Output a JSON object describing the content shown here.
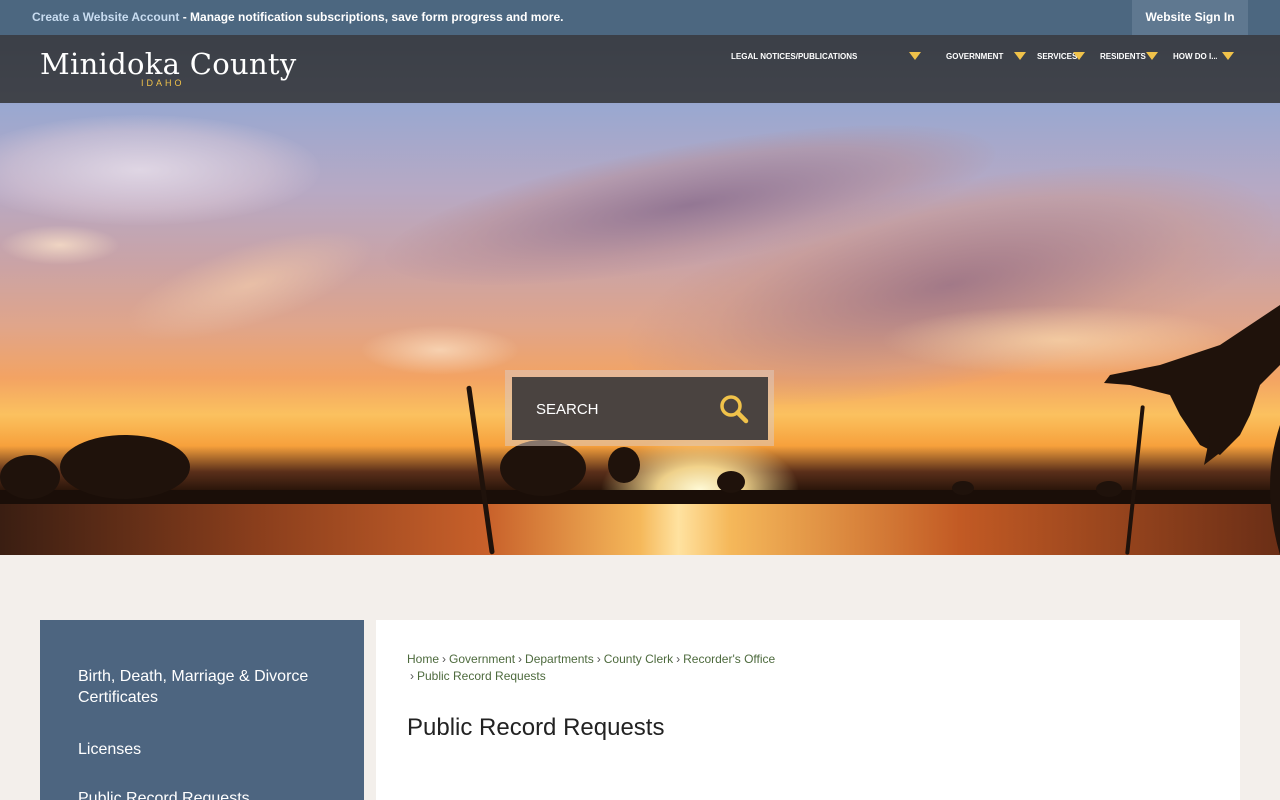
{
  "topbar": {
    "link_text": "Create a Website Account",
    "message": " - Manage notification subscriptions, save form progress and more.",
    "signin_label": "Website Sign In"
  },
  "header": {
    "logo_title": "Minidoka County",
    "logo_subtitle": "IDAHO",
    "nav": [
      {
        "label": "LEGAL NOTICES/PUBLICATIONS"
      },
      {
        "label": "GOVERNMENT"
      },
      {
        "label": "SERVICES"
      },
      {
        "label": "RESIDENTS"
      },
      {
        "label": "HOW DO I..."
      }
    ]
  },
  "search": {
    "placeholder": "SEARCH",
    "icon": "search-icon"
  },
  "sidebar": {
    "items": [
      {
        "label": "Birth, Death, Marriage & Divorce Certificates"
      },
      {
        "label": "Licenses"
      },
      {
        "label": "Public Record Requests"
      }
    ]
  },
  "breadcrumb": {
    "items": [
      "Home",
      "Government",
      "Departments",
      "County Clerk",
      "Recorder's Office",
      "Public Record Requests"
    ],
    "separator": "›"
  },
  "page": {
    "title": "Public Record Requests"
  },
  "colors": {
    "topbar": "#4c6780",
    "accent": "#f0c24a",
    "sidebar": "#4d6580",
    "breadcrumb_link": "#4d6a3d"
  }
}
